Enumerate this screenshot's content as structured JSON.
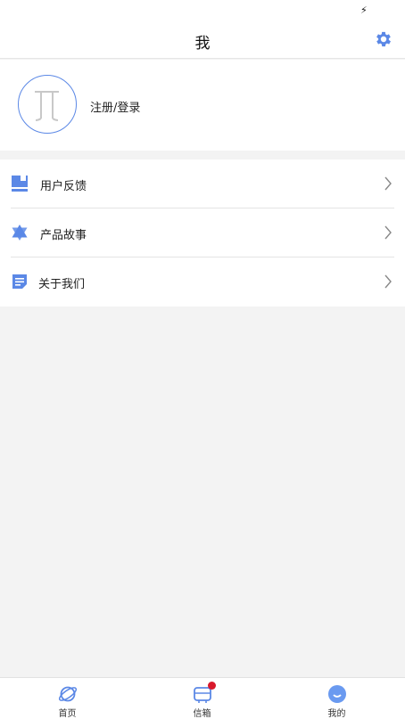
{
  "status_bar": {
    "charging_icon": "charging-bolt-icon"
  },
  "header": {
    "title": "我",
    "settings_icon": "gear-icon"
  },
  "profile": {
    "login_label": "注册/登录",
    "avatar_icon": "avatar-placeholder-icon"
  },
  "menu": {
    "items": [
      {
        "label": "用户反馈",
        "icon": "feedback-icon"
      },
      {
        "label": "产品故事",
        "icon": "star-of-david-icon"
      },
      {
        "label": "关于我们",
        "icon": "document-icon"
      }
    ]
  },
  "tabbar": {
    "tabs": [
      {
        "label": "首页",
        "icon": "planet-icon"
      },
      {
        "label": "信箱",
        "icon": "mailbox-icon",
        "has_badge": true
      },
      {
        "label": "我的",
        "icon": "smiley-icon",
        "selected": true
      }
    ]
  },
  "colors": {
    "accent": "#5b88e6",
    "badge": "#d8182b",
    "background": "#f3f3f3"
  }
}
